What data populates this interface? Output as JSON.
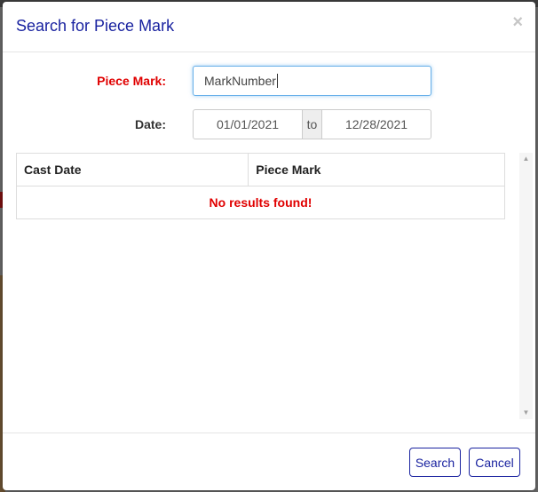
{
  "dialog": {
    "title": "Search for Piece Mark",
    "close_glyph": "×"
  },
  "form": {
    "piece_mark_label": "Piece Mark:",
    "piece_mark_value": "MarkNumber",
    "date_label": "Date:",
    "date_from": "01/01/2021",
    "date_separator": "to",
    "date_to": "12/28/2021"
  },
  "results": {
    "columns": [
      "Cast Date",
      "Piece Mark"
    ],
    "empty_message": "No results found!"
  },
  "footer": {
    "search_label": "Search",
    "cancel_label": "Cancel"
  },
  "colors": {
    "accent": "#1a23a0",
    "required_label": "#e00000",
    "empty_message": "#e00000"
  }
}
